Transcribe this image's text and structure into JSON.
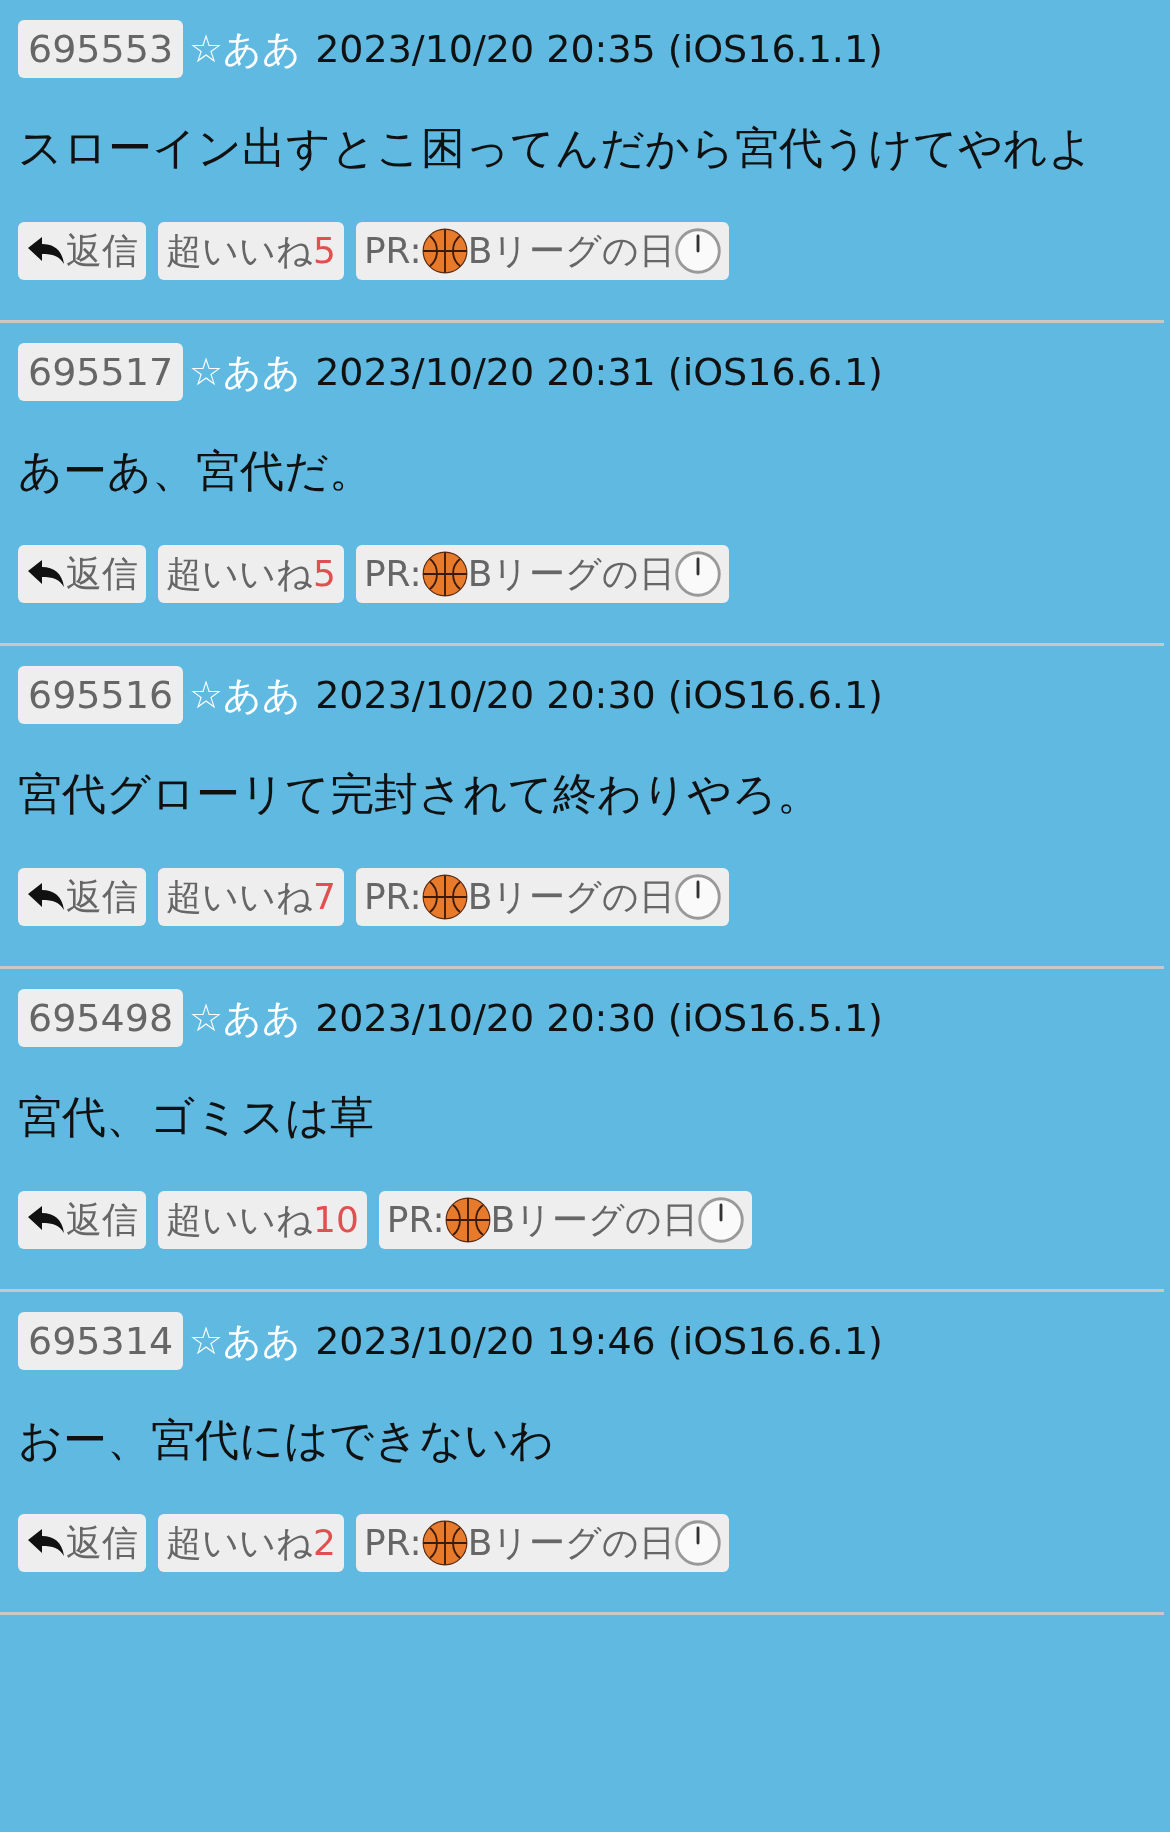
{
  "posts": [
    {
      "number": "695553",
      "name": "☆ああ",
      "date": "2023/10/20 20:35 (iOS16.1.1)",
      "body": "スローイン出すとこ困ってんだから宮代うけてやれよ",
      "reply": "返信",
      "like_label": "超いいね",
      "like_count": "5",
      "pr_prefix": "PR:",
      "pr_text": "Bリーグの日"
    },
    {
      "number": "695517",
      "name": "☆ああ",
      "date": "2023/10/20 20:31 (iOS16.6.1)",
      "body": "あーあ、宮代だ。",
      "reply": "返信",
      "like_label": "超いいね",
      "like_count": "5",
      "pr_prefix": "PR:",
      "pr_text": "Bリーグの日"
    },
    {
      "number": "695516",
      "name": "☆ああ",
      "date": "2023/10/20 20:30 (iOS16.6.1)",
      "body": "宮代グローリて完封されて終わりやろ。",
      "reply": "返信",
      "like_label": "超いいね",
      "like_count": "7",
      "pr_prefix": "PR:",
      "pr_text": "Bリーグの日"
    },
    {
      "number": "695498",
      "name": "☆ああ",
      "date": "2023/10/20 20:30 (iOS16.5.1)",
      "body": "宮代、ゴミスは草",
      "reply": "返信",
      "like_label": "超いいね",
      "like_count": "10",
      "pr_prefix": "PR:",
      "pr_text": "Bリーグの日"
    },
    {
      "number": "695314",
      "name": "☆ああ",
      "date": "2023/10/20 19:46 (iOS16.6.1)",
      "body": "おー、宮代にはできないわ",
      "reply": "返信",
      "like_label": "超いいね",
      "like_count": "2",
      "pr_prefix": "PR:",
      "pr_text": "Bリーグの日"
    }
  ]
}
